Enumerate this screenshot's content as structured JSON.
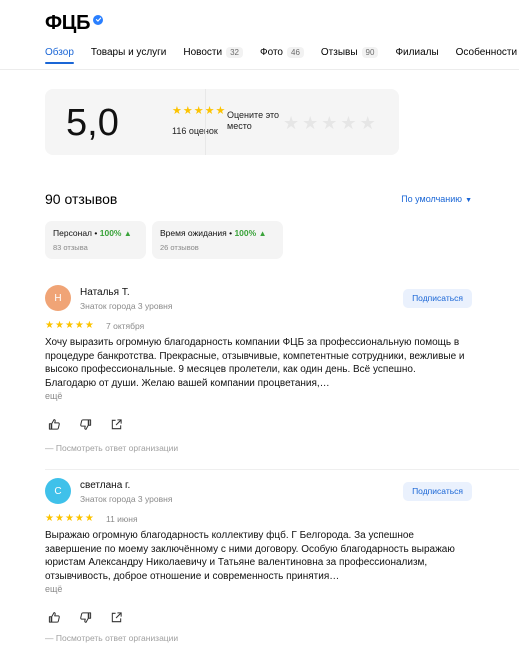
{
  "org": {
    "name": "ФЦБ"
  },
  "tabs": [
    {
      "label": "Обзор",
      "count": ""
    },
    {
      "label": "Товары и услуги",
      "count": ""
    },
    {
      "label": "Новости",
      "count": "32"
    },
    {
      "label": "Фото",
      "count": "46"
    },
    {
      "label": "Отзывы",
      "count": "90"
    },
    {
      "label": "Филиалы",
      "count": ""
    },
    {
      "label": "Особенности",
      "count": ""
    }
  ],
  "rating": {
    "score": "5,0",
    "count_label": "116 оценок",
    "rate_label": "Оцените это место",
    "stars_filled": 5,
    "stars_total": 5
  },
  "reviews_header": {
    "title": "90 отзывов",
    "sort_label": "По умолчанию"
  },
  "chips": [
    {
      "label": "Персонал",
      "percent": "100%",
      "sub": "83 отзыва"
    },
    {
      "label": "Время ожидания",
      "percent": "100%",
      "sub": "26 отзывов"
    }
  ],
  "reviews": [
    {
      "initial": "Н",
      "avatar_color": "#f0a476",
      "author": "Наталья Т.",
      "level": "Знаток города 3 уровня",
      "subscribe_label": "Подписаться",
      "stars": 5,
      "date": "7 октября",
      "text": "Хочу выразить огромную благодарность компании ФЦБ за профессиональную помощь в процедуре банкротства. Прекрасные, отзывчивые, компетентные сотрудники, вежливые и высоко профессиональные. 9 месяцев пролетели, как один день. Всё успешно. Благодарю от души. Желаю вашей компании процветания,…",
      "more_label": "ещё",
      "org_answer_label": "Посмотреть ответ организации"
    },
    {
      "initial": "С",
      "avatar_color": "#3fc1ea",
      "author": "светлана г.",
      "level": "Знаток города 3 уровня",
      "subscribe_label": "Подписаться",
      "stars": 5,
      "date": "11 июня",
      "text": "Выражаю огромную благодарность коллективу фцб. Г Белгорода. За успешное завершение по моему заключённому с ними договору. Особую благодарность выражаю юристам Александру Николаевичу и Татьяне валентиновна за профессионализм, отзывчивость, доброе отношение и современность принятия…",
      "more_label": "ещё",
      "org_answer_label": "Посмотреть ответ организации"
    }
  ],
  "colors": {
    "accent": "#1a66d6",
    "star": "#fcc300",
    "positive": "#3aa33a"
  },
  "icons": [
    "verified-badge-icon",
    "like-icon",
    "dislike-icon",
    "share-icon",
    "thumb-up-icon",
    "chevron-down-icon"
  ]
}
